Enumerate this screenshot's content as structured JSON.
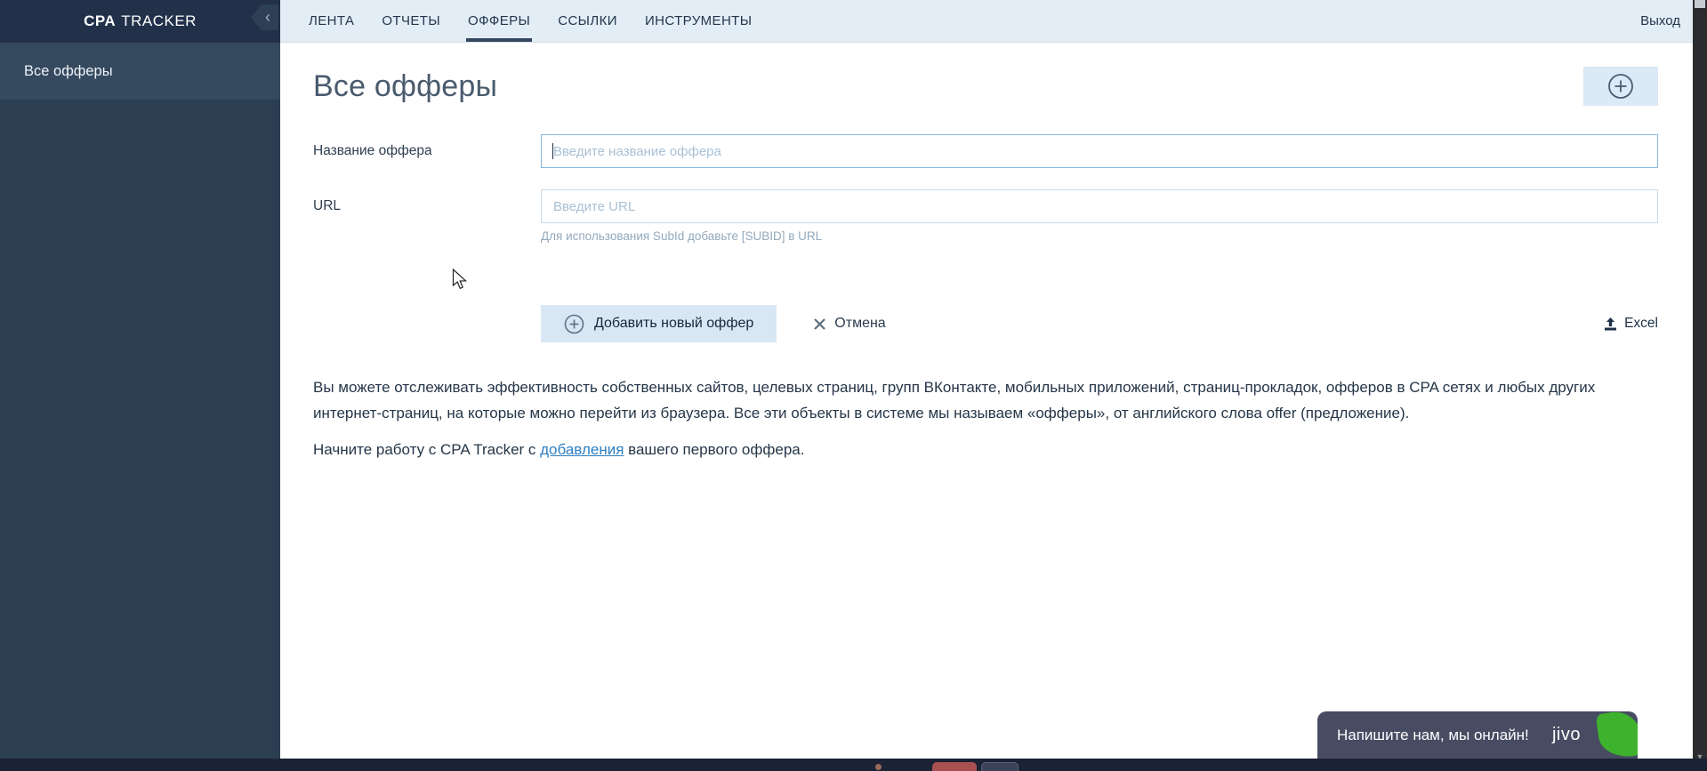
{
  "sidebar": {
    "logo_bold": "CPA",
    "logo_rest": "TRACKER",
    "items": [
      {
        "label": "Все офферы",
        "active": true
      }
    ]
  },
  "topnav": {
    "tabs": [
      {
        "label": "ЛЕНТА",
        "active": false
      },
      {
        "label": "ОТЧЕТЫ",
        "active": false
      },
      {
        "label": "ОФФЕРЫ",
        "active": true
      },
      {
        "label": "ССЫЛКИ",
        "active": false
      },
      {
        "label": "ИНСТРУМЕНТЫ",
        "active": false
      }
    ],
    "logout_label": "Выход"
  },
  "main": {
    "title": "Все офферы",
    "form": {
      "name_label": "Название оффера",
      "name_placeholder": "Введите название оффера",
      "name_value": "",
      "url_label": "URL",
      "url_placeholder": "Введите URL",
      "url_value": "",
      "url_hint": "Для использования SubId добавьте [SUBID] в URL",
      "submit_label": "Добавить новый оффер",
      "cancel_label": "Отмена",
      "excel_label": "Excel"
    },
    "intro_text": "Вы можете отслеживать эффективность собственных сайтов, целевых страниц, групп ВКонтакте, мобильных приложений, страниц-прокладок, офферов в CPA сетях и любых других интернет-страниц, на которые можно перейти из браузера. Все эти объекты в системе мы называем «офферы», от английского слова offer (предложение).",
    "start_text_before": "Начните работу с CPA Tracker с ",
    "start_link": "добавления",
    "start_text_after": " вашего первого оффера."
  },
  "chat": {
    "message": "Напишите нам, мы онлайн!",
    "brand": "jivo"
  },
  "icons": {
    "collapse_glyph": "‹",
    "scroll_down_glyph": "▼"
  },
  "colors": {
    "sidebar_header_bg": "#22304a",
    "sidebar_bg": "#2c3e52",
    "sidebar_active_bg": "#35495f",
    "topbar_bg": "#e3edf6",
    "accent_button_bg": "#d9e7f4",
    "focused_input_border": "#85b7dc",
    "link": "#2d7fc1",
    "jivo_bg": "#474c63",
    "jivo_green": "#3eb22c",
    "bottom_bar_bg": "#1b2234"
  }
}
